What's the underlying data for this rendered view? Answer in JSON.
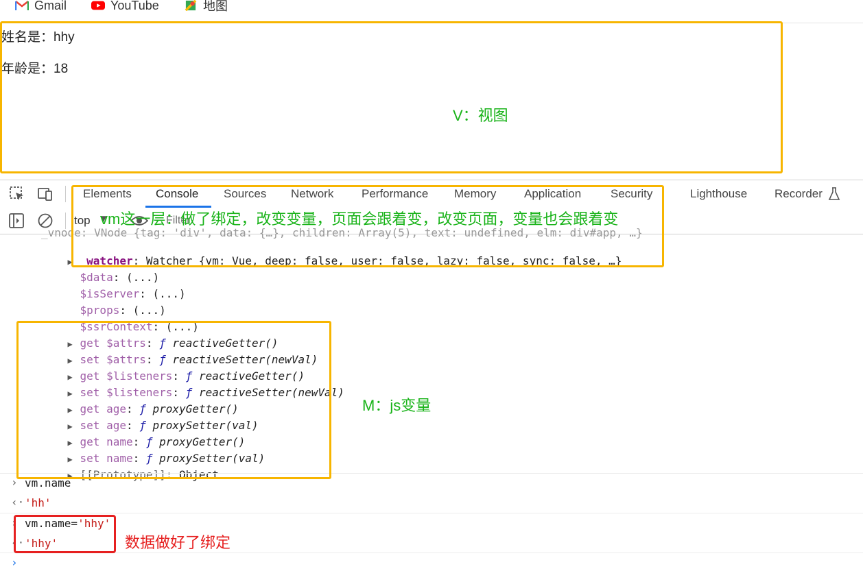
{
  "bookmarks": [
    {
      "label": "Gmail",
      "icon": "gmail-icon"
    },
    {
      "label": "YouTube",
      "icon": "youtube-icon"
    },
    {
      "label": "地图",
      "icon": "maps-icon"
    }
  ],
  "view": {
    "name_line": "姓名是：hhy",
    "age_line": "年龄是：18"
  },
  "annotations": {
    "view": "V：视图",
    "vm": "vm这一层：做了绑定，改变变量，页面会跟着变，改变页面，变量也会跟着变",
    "model": "M：js变量",
    "binding": "数据做好了绑定"
  },
  "devtools": {
    "tabs": [
      "Elements",
      "Console",
      "Sources",
      "Network",
      "Performance",
      "Memory",
      "Application",
      "Security",
      "Lighthouse",
      "Recorder"
    ],
    "active_tab": "Console",
    "context": "top",
    "filter_placeholder": "Filter"
  },
  "console": {
    "vnode_line": "_vnode: VNode {tag: 'div', data: {…}, children: Array(5), text: undefined, elm: div#app, …}",
    "watcher_key": "_watcher",
    "watcher_val": "Watcher {vm: Vue, deep: false, user: false, lazy: false, sync: false, …}",
    "props": [
      {
        "key": "$data",
        "val": "(...)"
      },
      {
        "key": "$isServer",
        "val": "(...)"
      },
      {
        "key": "$props",
        "val": "(...)"
      },
      {
        "key": "$ssrContext",
        "val": "(...)"
      }
    ],
    "accessors": [
      {
        "kind": "get",
        "key": "$attrs",
        "fn": "reactiveGetter()"
      },
      {
        "kind": "set",
        "key": "$attrs",
        "fn": "reactiveSetter(newVal)"
      },
      {
        "kind": "get",
        "key": "$listeners",
        "fn": "reactiveGetter()"
      },
      {
        "kind": "set",
        "key": "$listeners",
        "fn": "reactiveSetter(newVal)"
      },
      {
        "kind": "get",
        "key": "age",
        "fn": "proxyGetter()"
      },
      {
        "kind": "set",
        "key": "age",
        "fn": "proxySetter(val)"
      },
      {
        "kind": "get",
        "key": "name",
        "fn": "proxyGetter()"
      },
      {
        "kind": "set",
        "key": "name",
        "fn": "proxySetter(val)"
      }
    ],
    "prototype_key": "[[Prototype]]",
    "prototype_val": "Object",
    "input1": "vm.name",
    "output1": "'hh'",
    "input2_prefix": "vm.name=",
    "input2_str": "'hhy'",
    "output2": "'hhy'",
    "colors": {
      "annotation_box": "#f7b500",
      "binding_box": "#e62020",
      "annotation_text": "#19b319"
    }
  }
}
